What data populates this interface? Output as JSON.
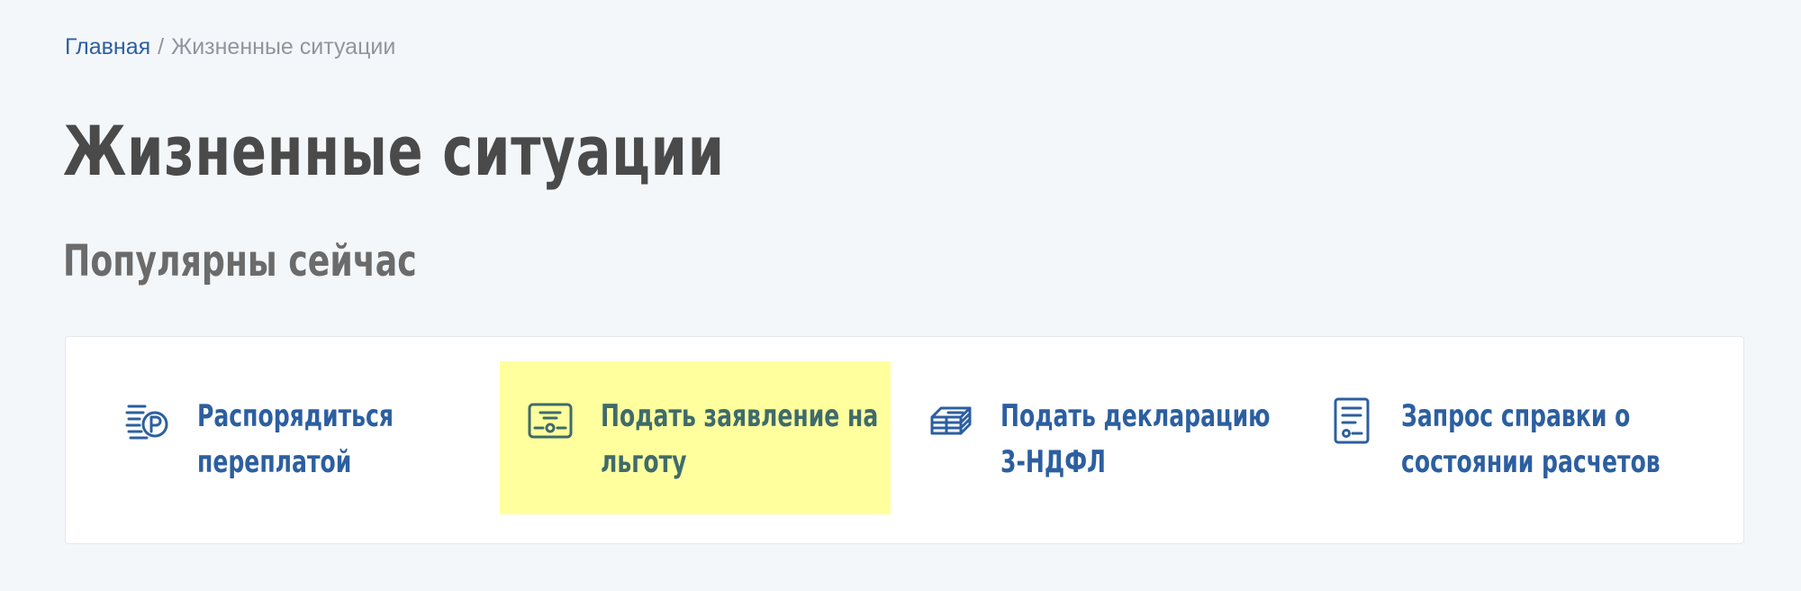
{
  "breadcrumb": {
    "home": "Главная",
    "separator": "/",
    "current": "Жизненные ситуации"
  },
  "page_title": "Жизненные ситуации",
  "section_title": "Популярны сейчас",
  "popular_items": [
    {
      "label": "Распорядиться переплатой",
      "icon": "overpayment-coins-icon"
    },
    {
      "label": "Подать заявление на льготу",
      "icon": "benefit-certificate-icon",
      "highlighted": true
    },
    {
      "label": "Подать декларацию 3-НДФЛ",
      "icon": "declaration-stack-icon"
    },
    {
      "label": "Запрос справки о состоянии расчетов",
      "icon": "statement-document-icon"
    }
  ],
  "colors": {
    "background": "#f4f7fa",
    "link": "#2c5fa0",
    "title": "#4a4a4a",
    "subtitle": "#6b6b6b",
    "highlight": "#ffff9e",
    "highlight_text": "#3f6b6b"
  }
}
